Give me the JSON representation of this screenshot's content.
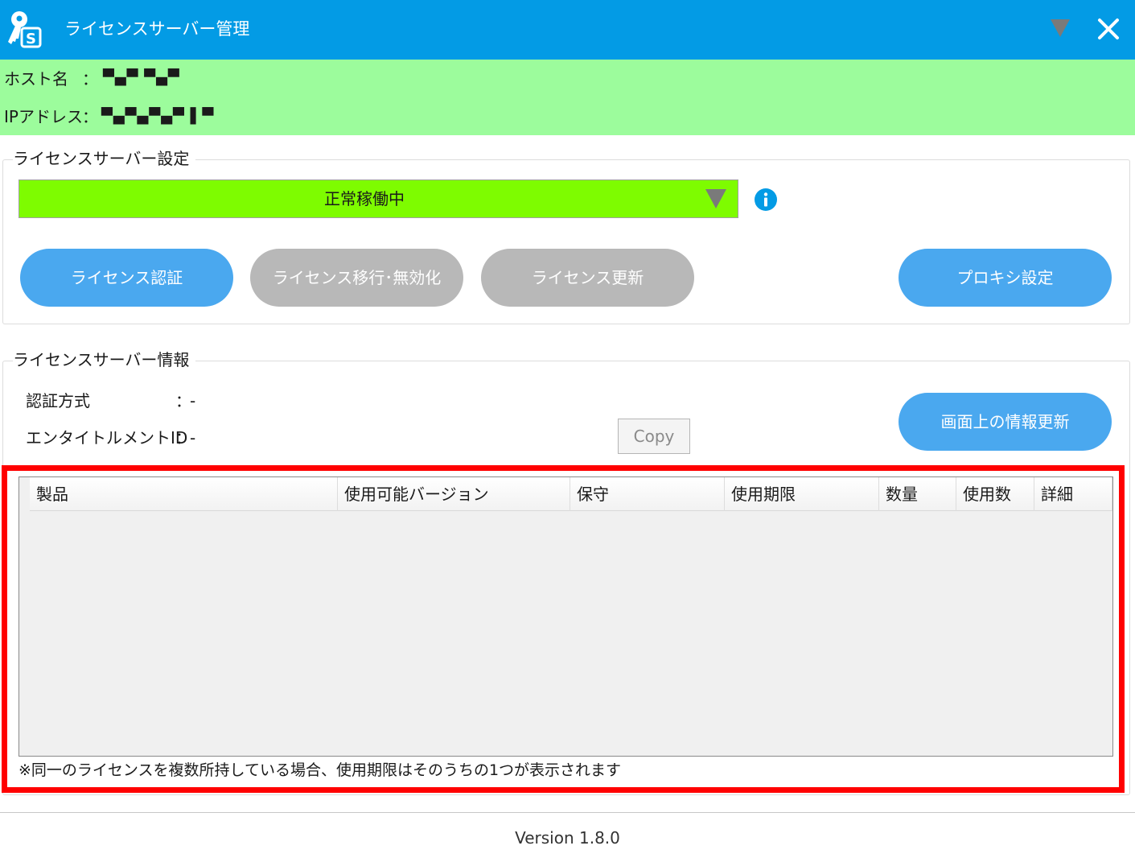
{
  "window": {
    "title": "ライセンスサーバー管理",
    "accent_color": "#039be5",
    "icons": {
      "app": "key-s-icon",
      "minimize": "triangle-down-icon",
      "close": "close-icon"
    }
  },
  "host": {
    "hostname_label": "ホスト名",
    "hostname_separator": "：",
    "hostname_value": "▀▄▀ ▀▄▀",
    "ip_label": "IPアドレス",
    "ip_separator": "：",
    "ip_value": "▀▄▀▄▀▄▀ ▌▀",
    "background_color": "#9cfc9c"
  },
  "settings": {
    "legend": "ライセンスサーバー設定",
    "status": {
      "value": "正常稼働中",
      "color": "#7efc00"
    },
    "info_icon": "info-icon",
    "buttons": {
      "authenticate": "ライセンス認証",
      "migrate": "ライセンス移行･無効化",
      "renew": "ライセンス更新",
      "proxy": "プロキシ設定"
    }
  },
  "server_info": {
    "legend": "ライセンスサーバー情報",
    "auth_method_label": "認証方式",
    "auth_method_separator": "：",
    "auth_method_value": "-",
    "entitlement_label": "エンタイトルメントID",
    "entitlement_separator": "：",
    "entitlement_value": "-",
    "copy_label": "Copy",
    "refresh_label": "画面上の情報更新"
  },
  "table": {
    "columns": [
      "製品",
      "使用可能バージョン",
      "保守",
      "使用期限",
      "数量",
      "使用数",
      "詳細"
    ],
    "rows": []
  },
  "note": "※同一のライセンスを複数所持している場合、使用期限はそのうちの1つが表示されます",
  "footer": {
    "version": "Version 1.8.0"
  }
}
